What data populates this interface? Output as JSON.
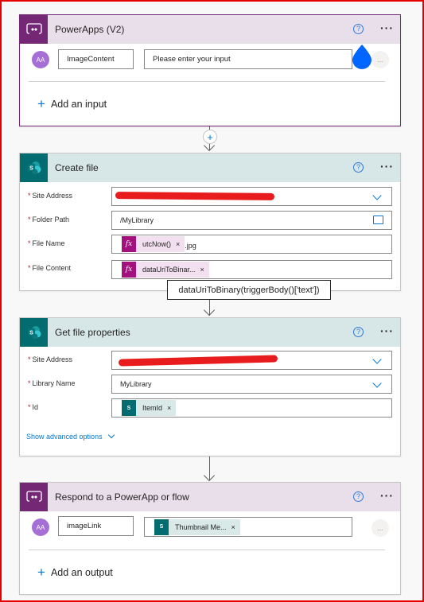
{
  "colors": {
    "powerapps_brand": "#742774",
    "powerapps_header_bg": "#e9dfeb",
    "sharepoint_brand": "#036c70",
    "sharepoint_header_bg": "#d7e6e6",
    "expression_token": "#a4107e",
    "link_blue": "#0078d4",
    "required_mark": "#a4262c",
    "redaction": "#e81c1c"
  },
  "steps": [
    {
      "title": "PowerApps (V2)",
      "icon": "powerapps-icon",
      "help_icon": "help-icon",
      "more_icon": "more-options-icon",
      "input": {
        "avatar": "AA",
        "name": "ImageContent",
        "value_placeholder": "Please enter your input",
        "more": "..."
      },
      "add_label": "Add an input"
    },
    {
      "title": "Create file",
      "icon": "sharepoint-icon",
      "fields": [
        {
          "label": "Site Address",
          "required": true,
          "value": "[redacted]",
          "control": "dropdown"
        },
        {
          "label": "Folder Path",
          "required": true,
          "value": "/MyLibrary",
          "control": "folder-picker"
        },
        {
          "label": "File Name",
          "required": true,
          "token": {
            "type": "expression",
            "label": "utcNow()",
            "icon": "fx"
          },
          "suffix": ".jpg"
        },
        {
          "label": "File Content",
          "required": true,
          "token": {
            "type": "expression",
            "label": "dataUriToBinar...",
            "icon": "fx"
          }
        }
      ],
      "tooltip": "dataUriToBinary(triggerBody()['text'])"
    },
    {
      "title": "Get file properties",
      "icon": "sharepoint-icon",
      "fields": [
        {
          "label": "Site Address",
          "required": true,
          "value": "[redacted]",
          "control": "dropdown"
        },
        {
          "label": "Library Name",
          "required": true,
          "value": "MyLibrary",
          "control": "dropdown"
        },
        {
          "label": "Id",
          "required": true,
          "token": {
            "type": "dynamic",
            "label": "ItemId",
            "icon": "sharepoint"
          }
        }
      ],
      "advanced_label": "Show advanced options"
    },
    {
      "title": "Respond to a PowerApp or flow",
      "icon": "powerapps-icon",
      "output": {
        "avatar": "AA",
        "name": "imageLink",
        "token": {
          "type": "dynamic",
          "label": "Thumbnail Me...",
          "icon": "sharepoint"
        },
        "more": "..."
      },
      "add_label": "Add an output"
    }
  ],
  "ui": {
    "required_mark": "*",
    "remove_token": "×",
    "help_glyph": "?",
    "more_glyph": "···",
    "plus_glyph": "+",
    "fx_glyph": "fx",
    "sp_glyph": "S"
  }
}
